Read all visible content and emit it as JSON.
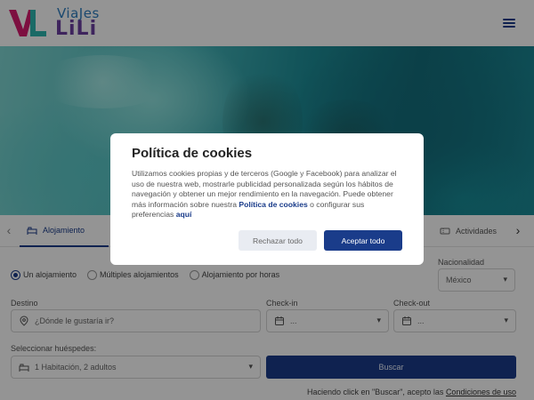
{
  "logo": {
    "line1": "ViaJes",
    "line2": "LiLi",
    "accent_pink": "#d81b6e",
    "accent_teal": "#2db7b0",
    "accent_purple": "#6b3fa0"
  },
  "header": {
    "menu_icon": "hamburger-menu-icon"
  },
  "tabs": {
    "items": [
      {
        "label": "Alojamiento",
        "icon": "bed-icon",
        "active": true
      },
      {
        "label": "Actividades",
        "icon": "ticket-icon",
        "active": false
      }
    ],
    "prev_icon": "chevron-left-icon",
    "next_icon": "chevron-right-icon"
  },
  "search": {
    "modes": [
      "Un alojamiento",
      "Múltiples alojamientos",
      "Alojamiento por horas"
    ],
    "selected_mode": "Un alojamiento",
    "nacionalidad": {
      "label": "Nacionalidad",
      "value": "México"
    },
    "destino": {
      "label": "Destino",
      "placeholder": "¿Dónde le gustaría ir?"
    },
    "checkin": {
      "label": "Check-in",
      "value": "..."
    },
    "checkout": {
      "label": "Check-out",
      "value": "..."
    },
    "guests": {
      "label": "Seleccionar huéspedes:",
      "value": "1 Habitación, 2 adultos"
    },
    "search_button": "Buscar",
    "terms_prefix": "Haciendo click en \"Buscar\", acepto las",
    "terms_link": "Condiciones de uso"
  },
  "cookie_modal": {
    "title": "Política de cookies",
    "text": "Utilizamos cookies propias y de terceros (Google y Facebook) para analizar el uso de nuestra web, mostrarle publicidad personalizada según los hábitos de navegación y obtener un mejor rendimiento en la navegación. Puede obtener más información sobre nuestra",
    "policy_link": "Política de cookies",
    "middle_text": "o configurar sus preferencias",
    "prefs_link": "aquí",
    "reject_label": "Rechazar todo",
    "accept_label": "Aceptar todo"
  },
  "colors": {
    "primary": "#1a3c8a",
    "overlay": "rgba(0,0,0,0.42)"
  }
}
